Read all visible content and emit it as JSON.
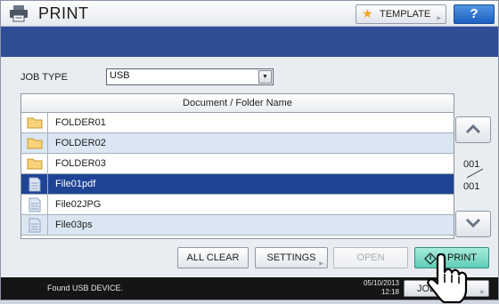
{
  "title": "PRINT",
  "title_icon": "printer-icon",
  "template_button": {
    "label": "TEMPLATE",
    "icon": "star-icon"
  },
  "help_button": {
    "label": "?"
  },
  "job_type": {
    "label": "JOB TYPE",
    "selected": "USB"
  },
  "file_list": {
    "header": "Document / Folder Name",
    "rows": [
      {
        "name": "FOLDER01",
        "kind": "folder"
      },
      {
        "name": "FOLDER02",
        "kind": "folder"
      },
      {
        "name": "FOLDER03",
        "kind": "folder"
      },
      {
        "name": "File01pdf",
        "kind": "file",
        "selected": true
      },
      {
        "name": "File02JPG",
        "kind": "file"
      },
      {
        "name": "File03ps",
        "kind": "file"
      }
    ]
  },
  "pager": {
    "current": "001",
    "total": "001"
  },
  "buttons": {
    "all_clear": "ALL CLEAR",
    "settings": "SETTINGS",
    "open": "OPEN",
    "print": "PRINT"
  },
  "status": {
    "message": "Found USB DEVICE.",
    "date": "05/10/2013",
    "time": "12:18",
    "job_status": "JOB S"
  },
  "colors": {
    "band": "#2f4e96",
    "selected_row": "#1f4496",
    "alt_row": "#dbe6f3",
    "print_button": "#5fcdb7",
    "help_button": "#1d5fbf"
  }
}
